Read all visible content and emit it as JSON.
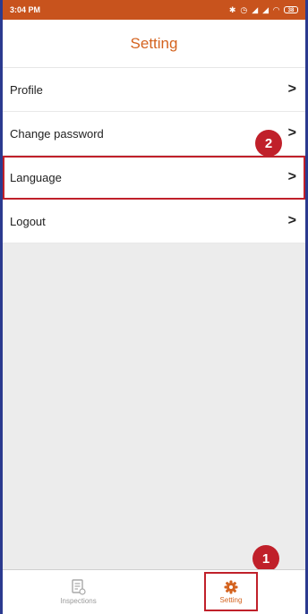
{
  "status_bar": {
    "time": "3:04 PM",
    "battery": "38"
  },
  "header": {
    "title": "Setting"
  },
  "menu": {
    "items": [
      {
        "label": "Profile",
        "chevron": ">"
      },
      {
        "label": "Change password",
        "chevron": ">"
      },
      {
        "label": "Language",
        "chevron": ">"
      },
      {
        "label": "Logout",
        "chevron": ">"
      }
    ]
  },
  "callouts": {
    "first": "1",
    "second": "2"
  },
  "tab_bar": {
    "tabs": [
      {
        "label": "Inspections",
        "icon": "document-list-icon",
        "active": false
      },
      {
        "label": "Setting",
        "icon": "gear-icon",
        "active": true
      }
    ]
  },
  "colors": {
    "accent": "#d4631f",
    "status_bar": "#c8531d",
    "highlight": "#c0202a",
    "frame_border": "#2b3a8f"
  }
}
